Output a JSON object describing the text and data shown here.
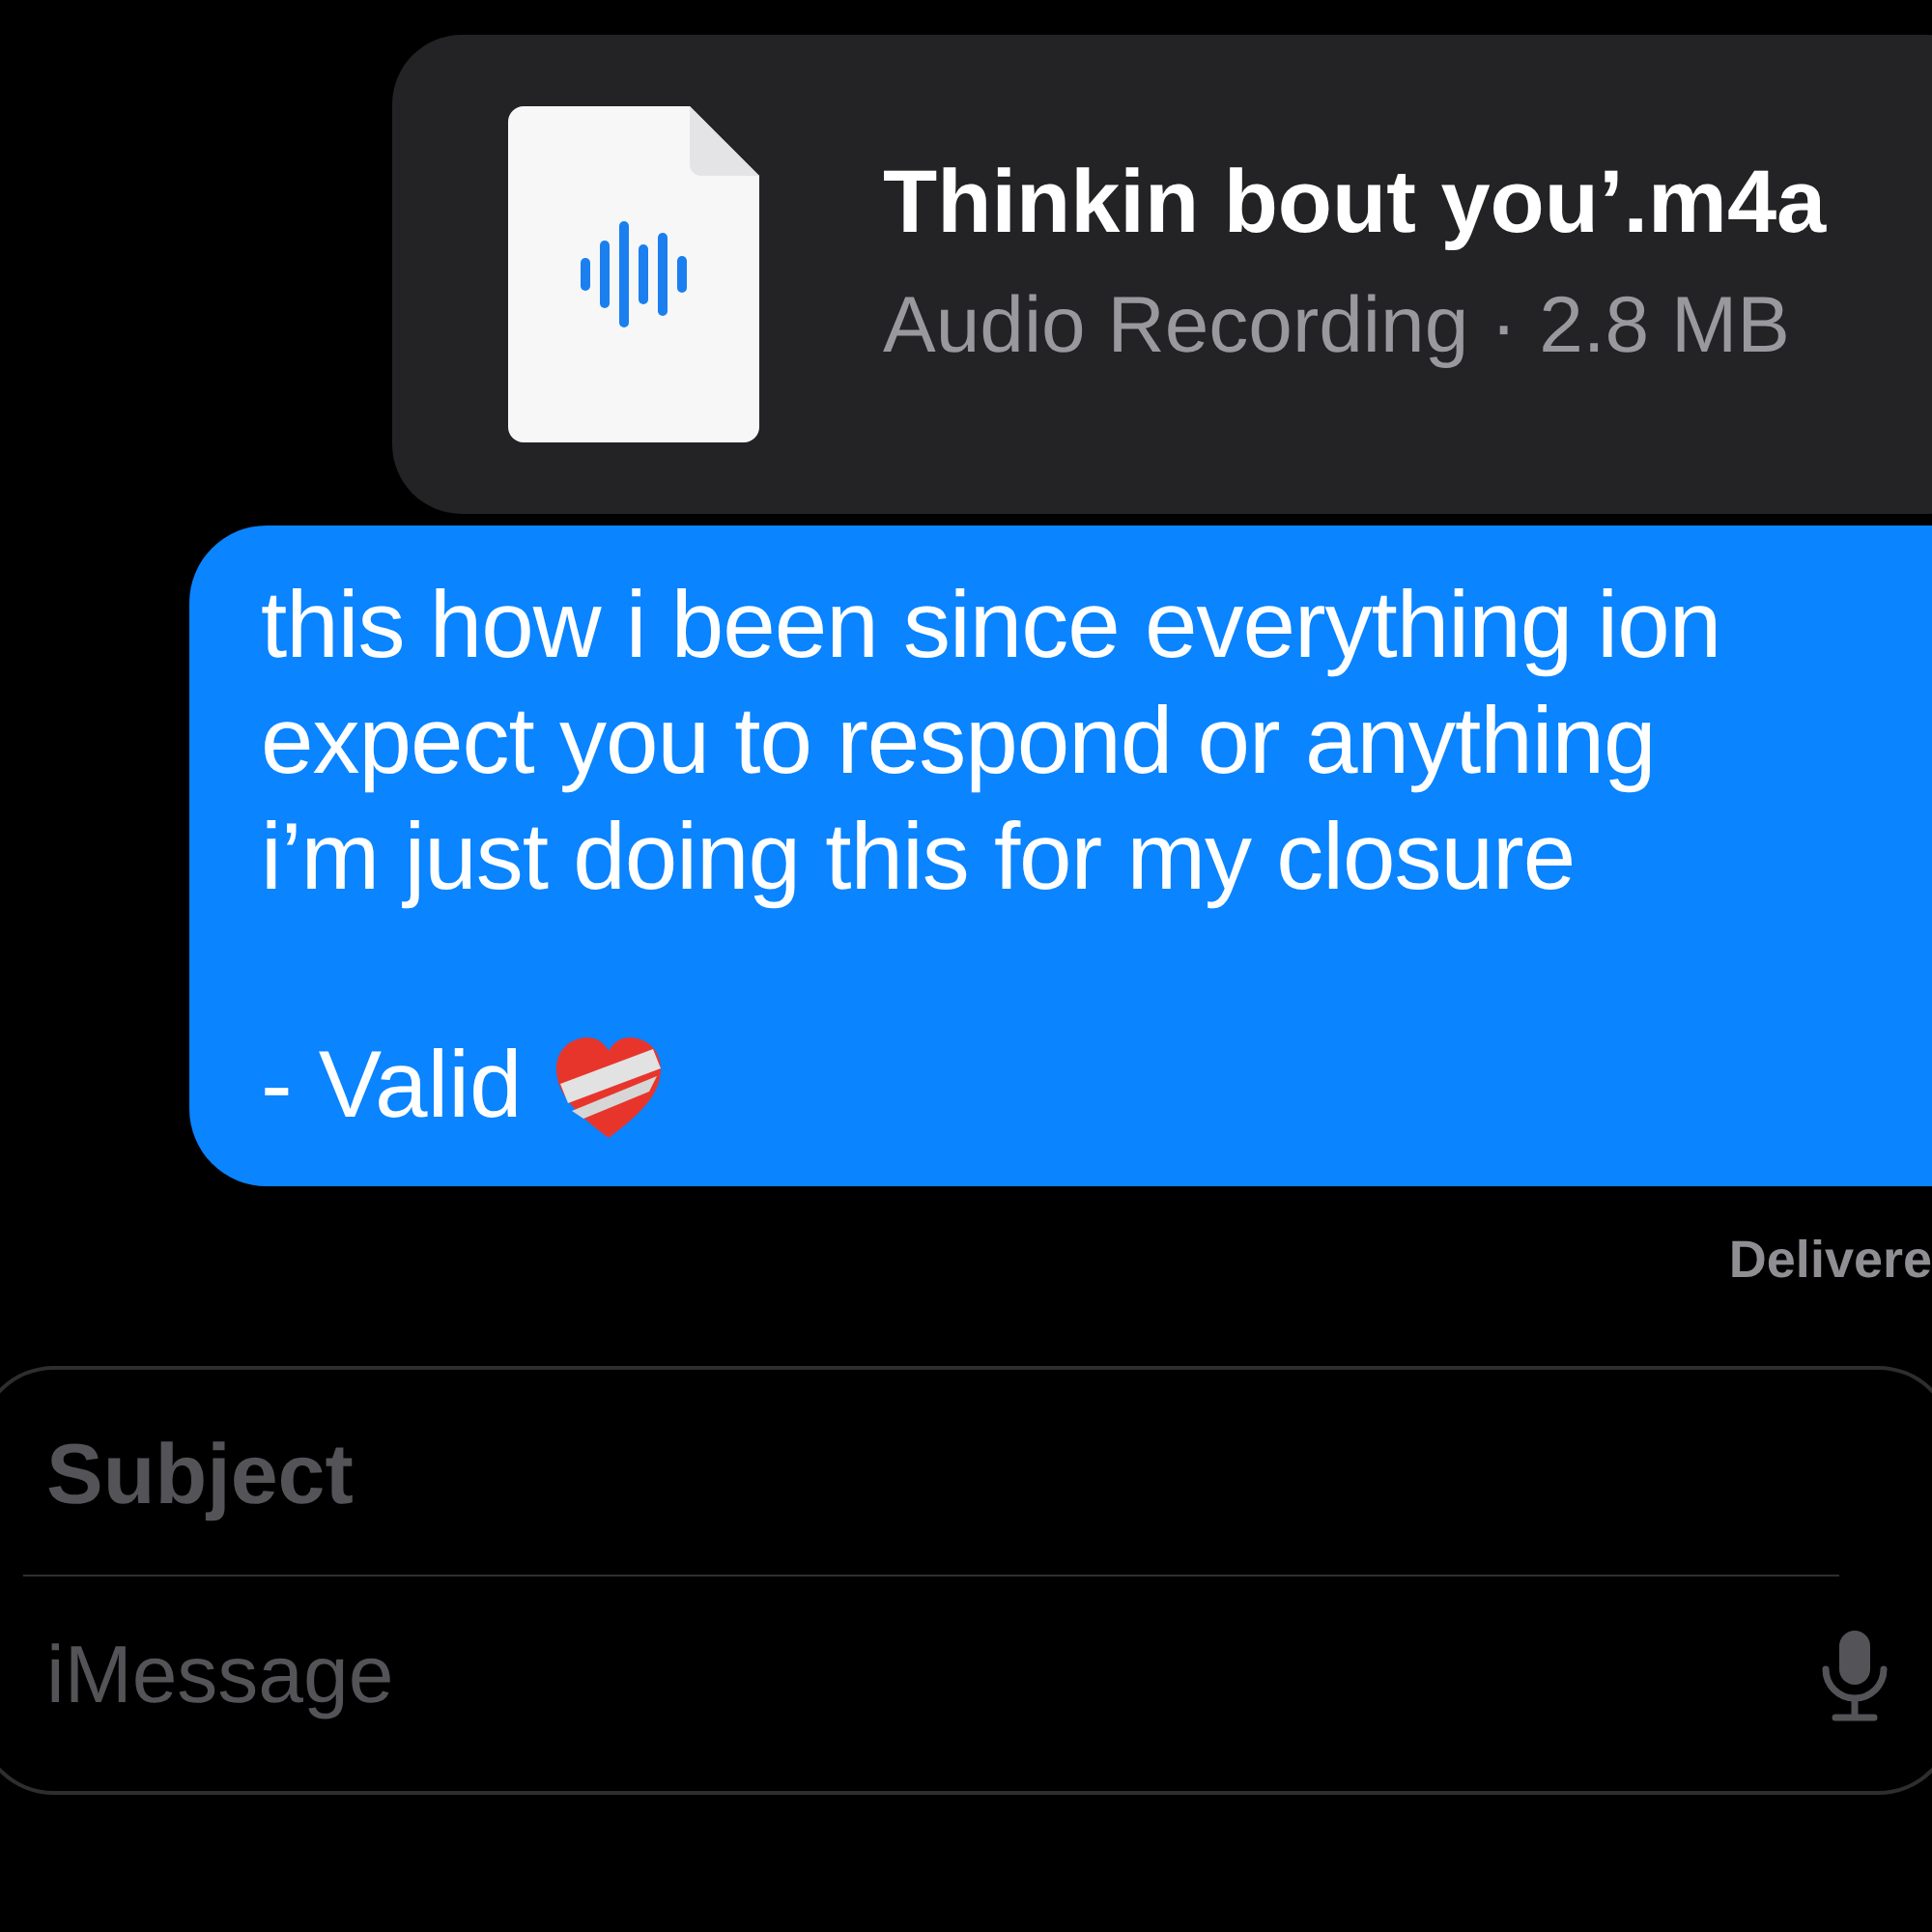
{
  "attachment": {
    "title": "Thinkin bout you’.m4a",
    "subtitle": "Audio Recording · 2.8 MB"
  },
  "message": {
    "lines": [
      "this how i been since everything ion",
      "expect you to respond or anything",
      "i’m just doing this for my closure"
    ],
    "signature": "- Valid"
  },
  "status": "Delivere",
  "compose": {
    "subject": {
      "placeholder": "Subject"
    },
    "message": {
      "placeholder": "iMessage"
    }
  }
}
